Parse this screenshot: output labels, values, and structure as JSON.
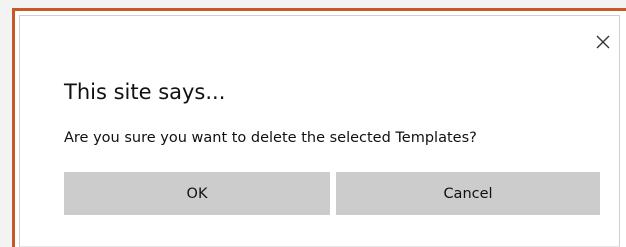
{
  "dialog": {
    "title": "This site says...",
    "message": "Are you sure you want to delete the selected Templates?",
    "ok_label": "OK",
    "cancel_label": "Cancel",
    "close_icon": "close-icon"
  },
  "colors": {
    "frame_border": "#c55a28",
    "button_bg": "#cccccc",
    "dialog_bg": "#ffffff"
  }
}
